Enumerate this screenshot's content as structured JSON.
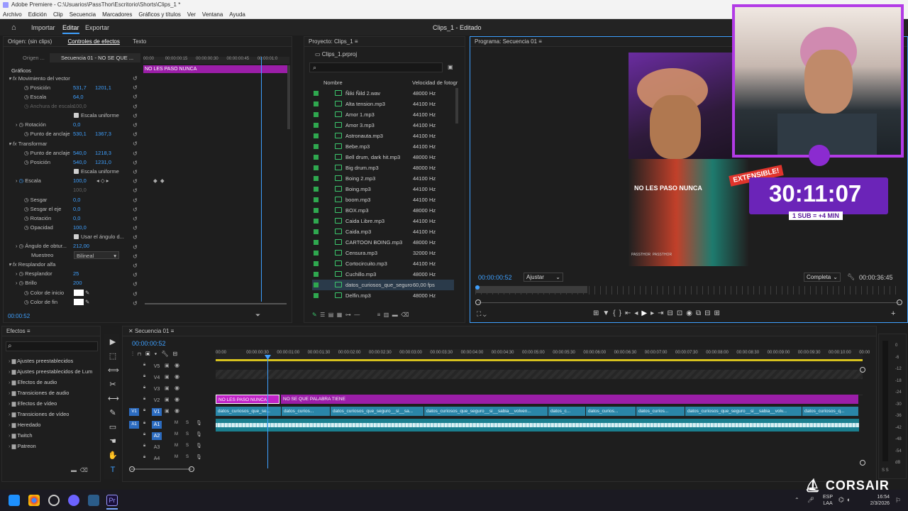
{
  "window": {
    "title": "Adobe Premiere - C:\\Usuarios\\PassThor\\Escritorio\\Shorts\\Clips_1 *",
    "doc_title": "Clips_1 - Editado"
  },
  "menu": [
    "Archivo",
    "Edición",
    "Clip",
    "Secuencia",
    "Marcadores",
    "Gráficos y títulos",
    "Ver",
    "Ventana",
    "Ayuda"
  ],
  "workspace": {
    "import": "Importar",
    "edit": "Editar",
    "export": "Exportar"
  },
  "source_panel": {
    "tabs": [
      "Origen: (sin clips)",
      "Controles de efectos",
      "Texto"
    ],
    "source_btn": "Origen ...",
    "sequence_btn": "Secuencia 01 - NO SE QUE ...",
    "clip_label": "NO LES PASO NUNCA",
    "timecodes": [
      "00:00",
      "00:00:00:15",
      "00:00:00:30",
      "00:00:00:45",
      "00:00:01:0"
    ],
    "current_time": "00:00:52"
  },
  "effects_controls": {
    "graphics": "Gráficos",
    "vector_motion": "Movimiento del vector",
    "position": "Posición",
    "pos_x": "531,7",
    "pos_y": "1201,1",
    "scale": "Escala",
    "scale_v": "64,0",
    "scale_w": "Anchura de escala",
    "scale_w_v": "100,0",
    "uniform": "Escala uniforme",
    "rotation": "Rotación",
    "rotation_v": "0,0",
    "anchor": "Punto de anclaje",
    "anchor_x": "530,1",
    "anchor_y": "1367,3",
    "transform": "Transformar",
    "t_anchor": "Punto de anclaje",
    "t_anchor_x": "540,0",
    "t_anchor_y": "1218,3",
    "t_position": "Posición",
    "t_pos_x": "540,0",
    "t_pos_y": "1231,0",
    "t_uniform": "Escala uniforme",
    "t_scale": "Escala",
    "t_scale_v": "100,0",
    "t_scale2": "100,0",
    "skew": "Sesgar",
    "skew_v": "0,0",
    "skew_axis": "Sesgar el eje",
    "skew_axis_v": "0,0",
    "t_rotation": "Rotación",
    "t_rotation_v": "0,0",
    "opacity": "Opacidad",
    "opacity_v": "100,0",
    "use_angle": "Usar el ángulo d...",
    "shutter": "Ángulo de obtur...",
    "shutter_v": "212,00",
    "sampling": "Muestreo",
    "sampling_v": "Bilineal",
    "glow": "Resplandor alfa",
    "glow_v": "Resplandor",
    "glow_vv": "25",
    "brightness": "Brillo",
    "brightness_v": "200",
    "start_color": "Color de inicio",
    "end_color": "Color de fin"
  },
  "project": {
    "tab": "Proyecto: Clips_1",
    "file": "Clips_1.prproj",
    "col_name": "Nombre",
    "col_fps": "Velocidad de fotogr",
    "items": [
      {
        "name": "Ñiki Ñild 2.wav",
        "fps": "48000 Hz"
      },
      {
        "name": "Alta tension.mp3",
        "fps": "44100 Hz"
      },
      {
        "name": "Amor 1.mp3",
        "fps": "44100 Hz"
      },
      {
        "name": "Amor 3.mp3",
        "fps": "44100 Hz"
      },
      {
        "name": "Astronauta.mp3",
        "fps": "44100 Hz"
      },
      {
        "name": "Bebe.mp3",
        "fps": "44100 Hz"
      },
      {
        "name": "Bell drum, dark hit.mp3",
        "fps": "48000 Hz"
      },
      {
        "name": "Big drum.mp3",
        "fps": "48000 Hz"
      },
      {
        "name": "Boing 2.mp3",
        "fps": "44100 Hz"
      },
      {
        "name": "Boing.mp3",
        "fps": "44100 Hz"
      },
      {
        "name": "boom.mp3",
        "fps": "44100 Hz"
      },
      {
        "name": "BOX.mp3",
        "fps": "48000 Hz"
      },
      {
        "name": "Caida Libre.mp3",
        "fps": "44100 Hz"
      },
      {
        "name": "Caida.mp3",
        "fps": "44100 Hz"
      },
      {
        "name": "CARTOON BOING.mp3",
        "fps": "48000 Hz"
      },
      {
        "name": "Censura.mp3",
        "fps": "32000 Hz"
      },
      {
        "name": "Cortocircuito.mp3",
        "fps": "44100 Hz"
      },
      {
        "name": "Cuchillo.mp3",
        "fps": "48000 Hz"
      },
      {
        "name": "datos_curiosos_que_seguro",
        "fps": "60,00 fps"
      },
      {
        "name": "Delfin.mp3",
        "fps": "48000 Hz"
      }
    ]
  },
  "program": {
    "tab": "Programa: Secuencia 01",
    "timecode": "00:00:00:52",
    "fit": "Ajustar",
    "quality": "Completa",
    "duration": "00:00:36:45",
    "overlay": {
      "timer": "30:11:07",
      "extensible": "EXTENSIBLE!",
      "sub": "1 SUB = +4 MIN",
      "caption": "NO LES PASO NUNCA",
      "brand": "PASSTHOR"
    }
  },
  "effects_panel": {
    "tab": "Efectos",
    "items": [
      "Ajustes preestablecidos",
      "Ajustes preestablecidos de Lum",
      "Efectos de audio",
      "Transiciones de audio",
      "Efectos de vídeo",
      "Transiciones de vídeo",
      "Heredado",
      "Twitch",
      "Patreon"
    ]
  },
  "timeline": {
    "tab": "Secuencia 01",
    "timecode": "00:00:00:52",
    "ruler": [
      "00:00",
      "00:00:00:30",
      "00:00:01:00",
      "00:00:01:30",
      "00:00:02:00",
      "00:00:02:30",
      "00:00:03:00",
      "00:00:03:30",
      "00:00:04:00",
      "00:00:04:30",
      "00:00:05:00",
      "00:00:05:30",
      "00:00:06:00",
      "00:00:06:30",
      "00:00:07:00",
      "00:00:07:30",
      "00:00:08:00",
      "00:00:08:30",
      "00:00:09:00",
      "00:00:09:30",
      "00:00:10:00",
      "00:00"
    ],
    "tracks": [
      "V5",
      "V4",
      "V3",
      "V2",
      "V1",
      "A1",
      "A2",
      "A3",
      "A4"
    ],
    "graphic_clips": [
      "NO LES PASO NUNCA",
      "NO SE QUE PALABRA TIENE"
    ],
    "video_clips": [
      "datos_curiosos_que_se...",
      "datos_curios...",
      "datos_curiosos_que_seguro__si__sa...",
      "datos_curiosos_que_seguro__si__sabia__volven...",
      "datos_c...",
      "datos_curios...",
      "datos_curios...",
      "datos_curiosos_que_seguro__si__sabia__volv...",
      "datos_curiosos_q..."
    ],
    "meter": [
      "0",
      "-6",
      "-12",
      "-18",
      "-24",
      "-30",
      "-36",
      "-42",
      "-48",
      "-54",
      "dB"
    ],
    "meter_ss": "S S"
  },
  "taskbar": {
    "lang1": "ESP",
    "lang2": "LAA",
    "time": "16:54",
    "date": "2/3/2026",
    "brand": "CORSAIR"
  },
  "colors": {
    "accent": "#3ea0ff",
    "graphic_clip": "#c022c7",
    "video_clip": "#2a86a8",
    "audio_clip": "#1b7f8f",
    "playhead": "#3ea0ff"
  }
}
